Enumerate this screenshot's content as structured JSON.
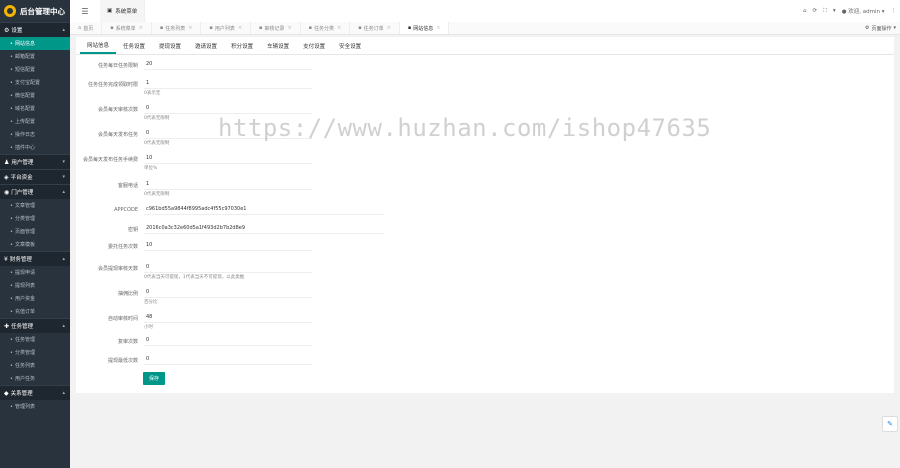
{
  "app": {
    "title": "后台管理中心",
    "brand_color": "#009688",
    "sidebar_bg": "#28333e"
  },
  "topbar": {
    "sys_menu": "系统菜单",
    "user": "欢迎, admin"
  },
  "sidebar": {
    "groups": [
      {
        "label": "设置",
        "icon": "gear-icon",
        "items": [
          "网站信息",
          "邮箱配置",
          "短信配置",
          "支付宝配置",
          "微信配置",
          "域名配置",
          "上传配置",
          "操作日志",
          "插件中心"
        ]
      },
      {
        "label": "用户管理",
        "icon": "user-icon",
        "items": []
      },
      {
        "label": "平台资金",
        "icon": "wallet-icon",
        "items": []
      },
      {
        "label": "门户管理",
        "icon": "portal-icon",
        "items": [
          "文章管理",
          "分类管理",
          "页面管理",
          "文章模板"
        ]
      },
      {
        "label": "财务管理",
        "icon": "finance-icon",
        "items": [
          "提现申请",
          "提现列表",
          "用户资金",
          "充值订单"
        ]
      },
      {
        "label": "任务管理",
        "icon": "task-icon",
        "items": [
          "任务管理",
          "分类管理",
          "任务列表",
          "用户任务"
        ]
      },
      {
        "label": "关系管理",
        "icon": "relation-icon",
        "items": [
          "管理列表"
        ]
      }
    ]
  },
  "tabs": {
    "items": [
      "首页",
      "系统菜单",
      "任务列表",
      "用户列表",
      "审核记录",
      "任务分类",
      "任务订单",
      "网站信息"
    ],
    "ops": "页面操作"
  },
  "subtabs": [
    "网站信息",
    "任务设置",
    "提现设置",
    "邀请设置",
    "积分设置",
    "车辆设置",
    "支付设置",
    "安全设置"
  ],
  "form": {
    "fields": [
      {
        "label": "任务每日任务限制",
        "value": "20",
        "help": ""
      },
      {
        "label": "任务任务完成领取时限",
        "value": "1",
        "help": "0表示无"
      },
      {
        "label": "会员每天审核次数",
        "value": "0",
        "help": "0代表无限制"
      },
      {
        "label": "会员每天发布任务",
        "value": "0",
        "help": "0代表无限制"
      },
      {
        "label": "会员每天发布任务手续费",
        "value": "10",
        "help": "单位%"
      },
      {
        "label": "客服电话",
        "value": "1",
        "help": "0代表无限制"
      },
      {
        "label": "APPCODE",
        "value": "c961bd55a9844f8995adc4f55c97030e1",
        "help": ""
      },
      {
        "label": "密钥",
        "value": "2016c0a3c32e60d5a1f493d2b7b2d8e9",
        "help": ""
      },
      {
        "label": "委托任务次数",
        "value": "10",
        "help": ""
      },
      {
        "label": "会员提现审核天数",
        "value": "0",
        "help": "0代表当天可提现，1代表当天不可提现，以此类推"
      },
      {
        "label": "抽佣比例",
        "value": "0",
        "help": "百分比"
      },
      {
        "label": "自动审核时间",
        "value": "48",
        "help": "小时"
      },
      {
        "label": "复审次数",
        "value": "0",
        "help": ""
      },
      {
        "label": "提现最低次数",
        "value": "0",
        "help": ""
      }
    ],
    "submit": "保存"
  },
  "watermark": "https://www.huzhan.com/ishop47635"
}
